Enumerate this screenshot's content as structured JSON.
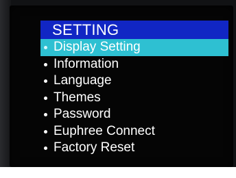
{
  "menu": {
    "title": "SETTING",
    "items": [
      {
        "label": "Display Setting",
        "selected": true
      },
      {
        "label": "Information",
        "selected": false
      },
      {
        "label": "Language",
        "selected": false
      },
      {
        "label": "Themes",
        "selected": false
      },
      {
        "label": "Password",
        "selected": false
      },
      {
        "label": "Euphree Connect",
        "selected": false
      },
      {
        "label": "Factory Reset",
        "selected": false
      }
    ]
  },
  "colors": {
    "title_bar": "#1126c4",
    "selection": "#2ec0d2",
    "background": "#050505",
    "text": "#ffffff"
  }
}
